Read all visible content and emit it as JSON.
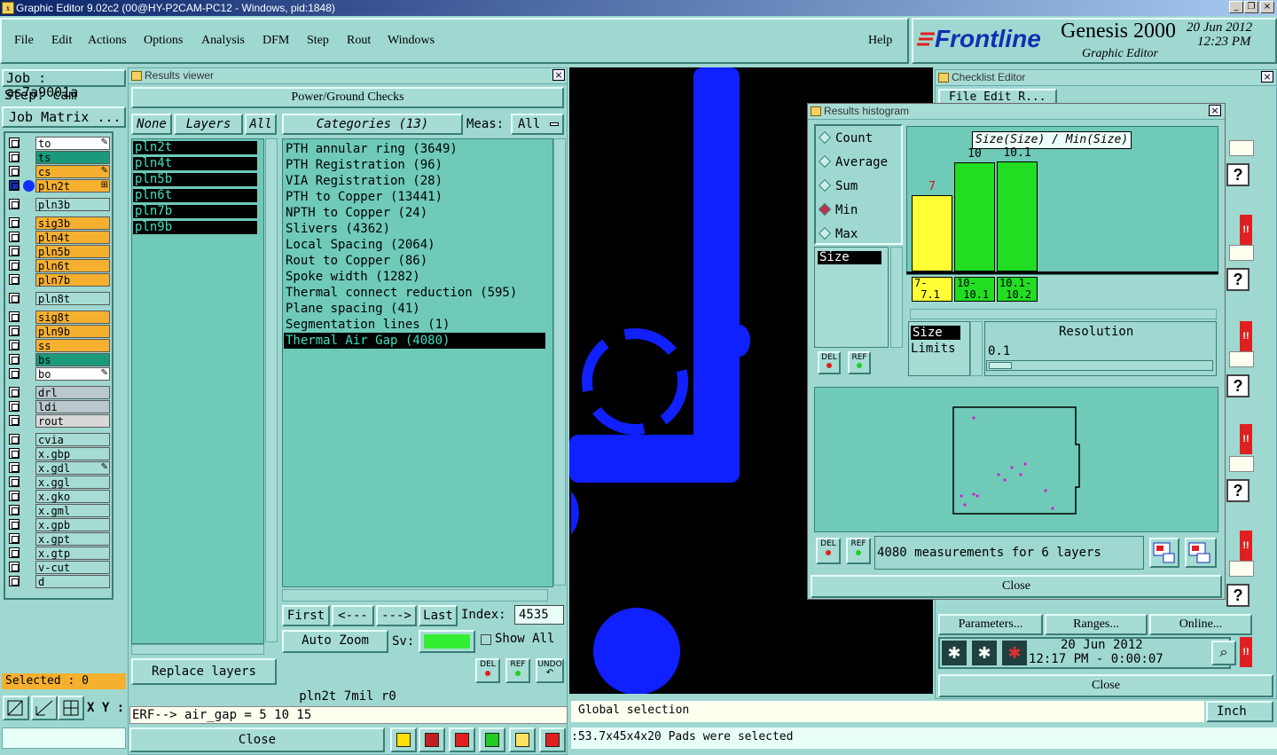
{
  "window": {
    "title": "Graphic Editor 9.02c2 (00@HY-P2CAM-PC12 - Windows, pid:1848)"
  },
  "menu": [
    "File",
    "Edit",
    "Actions",
    "Options",
    "Analysis",
    "DFM",
    "Step",
    "Rout",
    "Windows"
  ],
  "help": "Help",
  "brand": {
    "logo": "Frontline",
    "product": "Genesis 2000",
    "sub": "Graphic Editor",
    "date": "20 Jun 2012",
    "time": "12:23 PM"
  },
  "job": {
    "job": "Job : as7a9001a",
    "step": "Step: cam",
    "matrix": "Job Matrix ..."
  },
  "layers": [
    {
      "name": "to",
      "color": "#ffffff",
      "mark": true
    },
    {
      "name": "ts",
      "color": "#1a9a7a"
    },
    {
      "name": "cs",
      "color": "#f5b030",
      "mark": true
    },
    {
      "name": "pln2t",
      "color": "#f5b030",
      "sel": true
    },
    {
      "name": "pln3b",
      "color": "#a6dcd4"
    },
    {
      "name": "sig3b",
      "color": "#f5b030"
    },
    {
      "name": "pln4t",
      "color": "#f5b030"
    },
    {
      "name": "pln5b",
      "color": "#f5b030"
    },
    {
      "name": "pln6t",
      "color": "#f5b030"
    },
    {
      "name": "pln7b",
      "color": "#f5b030"
    },
    {
      "name": "pln8t",
      "color": "#a6dcd4"
    },
    {
      "name": "sig8t",
      "color": "#f5b030"
    },
    {
      "name": "pln9b",
      "color": "#f5b030"
    },
    {
      "name": "ss",
      "color": "#f5b030"
    },
    {
      "name": "bs",
      "color": "#1a9a7a"
    },
    {
      "name": "bo",
      "color": "#ffffff",
      "mark": true
    },
    {
      "name": "drl",
      "color": "#b8c8cc"
    },
    {
      "name": "ldi",
      "color": "#b8c8cc"
    },
    {
      "name": "rout",
      "color": "#d8d8d8"
    },
    {
      "name": "cvia",
      "color": "#a6dcd4"
    },
    {
      "name": "x.gbp",
      "color": "#a6dcd4"
    },
    {
      "name": "x.gdl",
      "color": "#a6dcd4",
      "mark": true
    },
    {
      "name": "x.ggl",
      "color": "#a6dcd4"
    },
    {
      "name": "x.gko",
      "color": "#a6dcd4"
    },
    {
      "name": "x.gml",
      "color": "#a6dcd4"
    },
    {
      "name": "x.gpb",
      "color": "#a6dcd4"
    },
    {
      "name": "x.gpt",
      "color": "#a6dcd4"
    },
    {
      "name": "x.gtp",
      "color": "#a6dcd4"
    },
    {
      "name": "v-cut",
      "color": "#a6dcd4"
    },
    {
      "name": "d",
      "color": "#a6dcd4"
    }
  ],
  "selected": "Selected : 0",
  "xy": "X Y :",
  "results_viewer": {
    "title": "Results viewer",
    "header": "Power/Ground Checks",
    "none": "None",
    "layers": "Layers",
    "all": "All",
    "categories": "Categories (13)",
    "meas_label": "Meas:",
    "meas_value": "All",
    "layer_list": [
      "pln2t",
      "pln4t",
      "pln5b",
      "pln6t",
      "pln7b",
      "pln9b"
    ],
    "category_list": [
      "PTH annular ring (3649)",
      "PTH Registration (96)",
      "VIA Registration (28)",
      "PTH to Copper (13441)",
      "NPTH to Copper (24)",
      "Slivers (4362)",
      "Local Spacing (2064)",
      "Rout to Copper (86)",
      "Spoke width (1282)",
      "Thermal connect reduction (595)",
      "Plane spacing (41)",
      "Segmentation lines (1)",
      "Thermal Air Gap (4080)"
    ],
    "first": "First",
    "prev": "<---",
    "next": "--->",
    "last": "Last",
    "index_label": "Index:",
    "index_value": "4535",
    "auto_zoom": "Auto Zoom",
    "sv": "Sv:",
    "show_all": "Show All",
    "replace_layers": "Replace layers",
    "del": "DEL",
    "ref": "REF",
    "undo": "UNDO",
    "status": "pln2t  7mil  r0",
    "erf": "ERF--> air_gap = 5 10 15",
    "close": "Close"
  },
  "histogram": {
    "title": "Results histogram",
    "modes": [
      "Count",
      "Average",
      "Sum",
      "Min",
      "Max"
    ],
    "selected_mode": "Min",
    "graph_title": "Size(Size) / Min(Size)",
    "bars": [
      {
        "label": "7",
        "range": "7-\n 7.1",
        "value": 7,
        "color": "#ffff33",
        "label_color": "#e01010"
      },
      {
        "label": "10",
        "range": "10-\n 10.1",
        "value": 10,
        "color": "#22dd22",
        "label_color": "#000000"
      },
      {
        "label": "10.1",
        "range": "10.1-\n 10.2",
        "value": 10.1,
        "color": "#22dd22",
        "label_color": "#000000"
      }
    ],
    "attr": "Size",
    "res_items": [
      "Size",
      "Limits"
    ],
    "resolution_label": "Resolution",
    "resolution_value": "0.1",
    "summary": "4080 measurements for 6 layers",
    "del": "DEL",
    "ref": "REF",
    "close": "Close"
  },
  "checklist": {
    "title": "Checklist Editor",
    "menu": "File  Edit  R...",
    "parameters": "Parameters...",
    "ranges": "Ranges...",
    "online": "Online...",
    "date": "20 Jun 2012",
    "time": "12:17 PM - 0:00:07",
    "close": "Close"
  },
  "status": {
    "global": "Global selection",
    "unit": "Inch",
    "message": ":53.7x45x4x20 Pads were selected"
  }
}
